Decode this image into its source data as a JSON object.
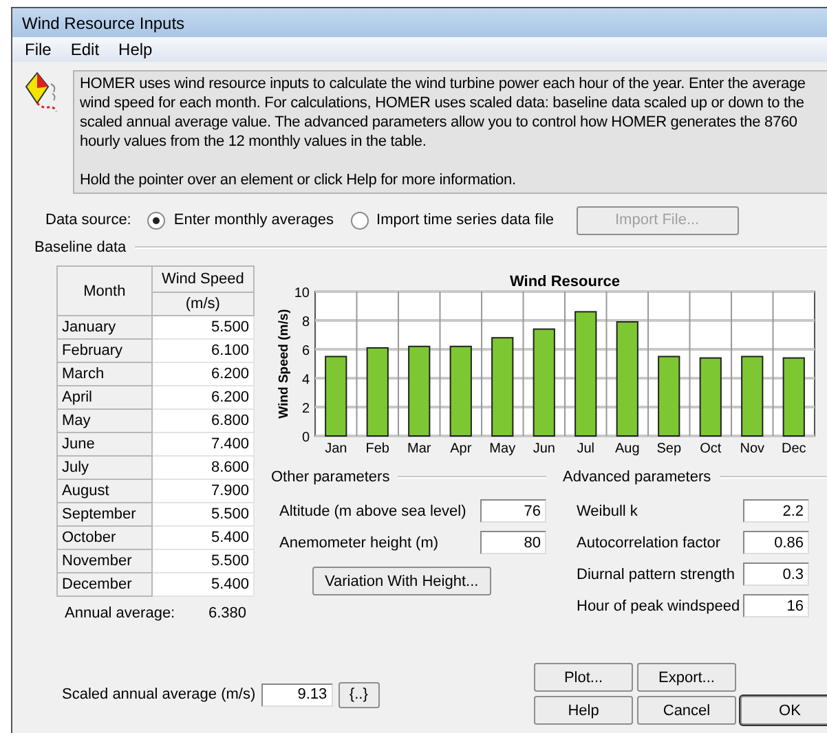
{
  "window": {
    "title": "Wind Resource Inputs"
  },
  "menu": [
    "File",
    "Edit",
    "Help"
  ],
  "info": {
    "text": "HOMER uses wind resource inputs to calculate the wind turbine power each hour of the year. Enter the average wind speed for each month. For calculations, HOMER uses scaled data: baseline data scaled up or down to the scaled annual average value. The advanced parameters allow you to control how HOMER generates the 8760 hourly values from the 12 monthly values in the table.",
    "hint": "Hold the pointer over an element or click Help for more information."
  },
  "data_source": {
    "label": "Data source:",
    "options": [
      {
        "label": "Enter monthly averages",
        "selected": true
      },
      {
        "label": "Import time series data file",
        "selected": false
      }
    ],
    "import_button": {
      "label": "Import File...",
      "disabled": true
    }
  },
  "baseline": {
    "title": "Baseline data",
    "table": {
      "columns": [
        "Month",
        "Wind Speed",
        "(m/s)"
      ],
      "rows": [
        {
          "month": "January",
          "speed": "5.500"
        },
        {
          "month": "February",
          "speed": "6.100"
        },
        {
          "month": "March",
          "speed": "6.200"
        },
        {
          "month": "April",
          "speed": "6.200"
        },
        {
          "month": "May",
          "speed": "6.800"
        },
        {
          "month": "June",
          "speed": "7.400"
        },
        {
          "month": "July",
          "speed": "8.600"
        },
        {
          "month": "August",
          "speed": "7.900"
        },
        {
          "month": "September",
          "speed": "5.500"
        },
        {
          "month": "October",
          "speed": "5.400"
        },
        {
          "month": "November",
          "speed": "5.500"
        },
        {
          "month": "December",
          "speed": "5.400"
        }
      ]
    },
    "annual_average": {
      "label": "Annual average:",
      "value": "6.380"
    },
    "chart_data": {
      "type": "bar",
      "title": "Wind Resource",
      "ylabel": "Wind Speed (m/s)",
      "categories": [
        "Jan",
        "Feb",
        "Mar",
        "Apr",
        "May",
        "Jun",
        "Jul",
        "Aug",
        "Sep",
        "Oct",
        "Nov",
        "Dec"
      ],
      "series": [
        {
          "color": "#7dc832",
          "values": [
            5.5,
            6.1,
            6.2,
            6.2,
            6.8,
            7.4,
            8.6,
            7.9,
            5.5,
            5.4,
            5.5,
            5.4
          ]
        }
      ],
      "ylim": [
        0,
        10
      ],
      "yticks": [
        0,
        2,
        4,
        6,
        8,
        10
      ],
      "grid": true
    }
  },
  "other_parameters": {
    "title": "Other parameters",
    "fields": [
      {
        "label": "Altitude (m above sea level)",
        "value": "76"
      },
      {
        "label": "Anemometer height (m)",
        "value": "80"
      }
    ],
    "button": "Variation With Height..."
  },
  "advanced_parameters": {
    "title": "Advanced parameters",
    "fields": [
      {
        "label": "Weibull k",
        "value": "2.2"
      },
      {
        "label": "Autocorrelation factor",
        "value": "0.86"
      },
      {
        "label": "Diurnal pattern strength",
        "value": "0.3"
      },
      {
        "label": "Hour of peak windspeed",
        "value": "16"
      }
    ]
  },
  "scaled_average": {
    "label": "Scaled annual average (m/s)",
    "value": "9.13",
    "button": "{..}"
  },
  "buttons": [
    {
      "label": "Plot...",
      "default": false
    },
    {
      "label": "Export...",
      "default": false
    },
    {
      "label": "Help",
      "default": false
    },
    {
      "label": "Cancel",
      "default": false
    },
    {
      "label": "OK",
      "default": true
    }
  ]
}
